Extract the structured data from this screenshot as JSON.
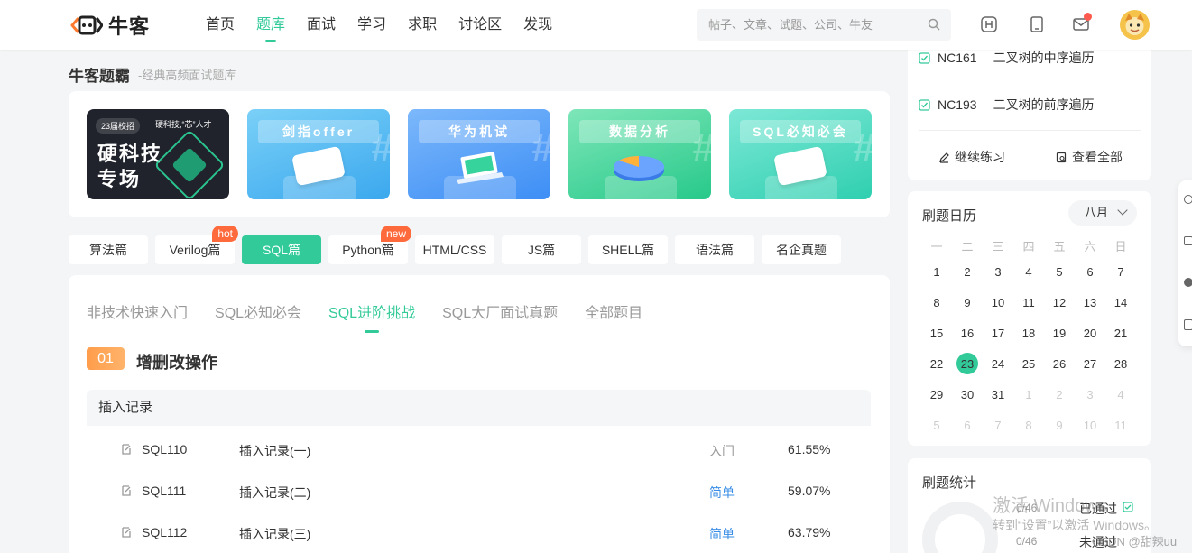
{
  "brand": {
    "name": "牛客"
  },
  "nav": {
    "items": [
      {
        "label": "首页"
      },
      {
        "label": "题库"
      },
      {
        "label": "面试"
      },
      {
        "label": "学习"
      },
      {
        "label": "求职"
      },
      {
        "label": "讨论区"
      },
      {
        "label": "发现"
      }
    ],
    "active": "题库"
  },
  "search": {
    "placeholder": "帖子、文章、试题、公司、牛友"
  },
  "page": {
    "title": "牛客题霸",
    "subtitle": "-经典高频面试题库"
  },
  "banners": [
    {
      "tag": "23届校招",
      "tag2": "硬科技,“芯”人才",
      "line1": "硬科技",
      "line2": "专场"
    },
    {
      "title": "剑指offer",
      "color": "#52b6f0"
    },
    {
      "title": "华为机试",
      "color": "#4f9ef7"
    },
    {
      "title": "数据分析",
      "color": "#34d39a"
    },
    {
      "title": "SQL必知必会",
      "color": "#38d7b7"
    }
  ],
  "categories": [
    {
      "label": "算法篇"
    },
    {
      "label": "Verilog篇",
      "badge": "hot"
    },
    {
      "label": "SQL篇"
    },
    {
      "label": "Python篇",
      "badge": "new"
    },
    {
      "label": "HTML/CSS"
    },
    {
      "label": "JS篇"
    },
    {
      "label": "SHELL篇"
    },
    {
      "label": "语法篇"
    },
    {
      "label": "名企真题"
    }
  ],
  "sub_tabs": [
    {
      "label": "非技术快速入门"
    },
    {
      "label": "SQL必知必会"
    },
    {
      "label": "SQL进阶挑战"
    },
    {
      "label": "SQL大厂面试真题"
    },
    {
      "label": "全部题目"
    }
  ],
  "section": {
    "number": "01",
    "title": "增删改操作"
  },
  "group": {
    "title": "插入记录"
  },
  "questions": [
    {
      "id": "SQL110",
      "name": "插入记录(一)",
      "level": "入门",
      "rate": "61.55%"
    },
    {
      "id": "SQL111",
      "name": "插入记录(二)",
      "level": "简单",
      "rate": "59.07%"
    },
    {
      "id": "SQL112",
      "name": "插入记录(三)",
      "level": "简单",
      "rate": "63.79%"
    }
  ],
  "recent": [
    {
      "id": "NC161",
      "name": "二叉树的中序遍历"
    },
    {
      "id": "NC193",
      "name": "二叉树的前序遍历"
    }
  ],
  "side_actions": {
    "continue": "继续练习",
    "view_all": "查看全部"
  },
  "calendar": {
    "title": "刷题日历",
    "month": "八月",
    "weekdays": [
      "一",
      "二",
      "三",
      "四",
      "五",
      "六",
      "日"
    ],
    "today": "23",
    "weeks": [
      [
        "1",
        "2",
        "3",
        "4",
        "5",
        "6",
        "7"
      ],
      [
        "8",
        "9",
        "10",
        "11",
        "12",
        "13",
        "14"
      ],
      [
        "15",
        "16",
        "17",
        "18",
        "19",
        "20",
        "21"
      ],
      [
        "22",
        "23",
        "24",
        "25",
        "26",
        "27",
        "28"
      ],
      [
        "29",
        "30",
        "31",
        "1",
        "2",
        "3",
        "4"
      ],
      [
        "5",
        "6",
        "7",
        "8",
        "9",
        "10",
        "11"
      ]
    ]
  },
  "stats": {
    "title": "刷题统计",
    "passed_count": "0/46",
    "passed_label": "已通过",
    "failed_count": "0/46",
    "failed_label": "未通过"
  },
  "watermark": {
    "line1": "激活 Windows",
    "line2": "转到“设置”以激活 Windows。",
    "line3": "CSDN @甜辣uu"
  },
  "colors": {
    "accent": "#32ca99",
    "hot": "#ff6a3d",
    "simple": "#3a8ee6"
  }
}
